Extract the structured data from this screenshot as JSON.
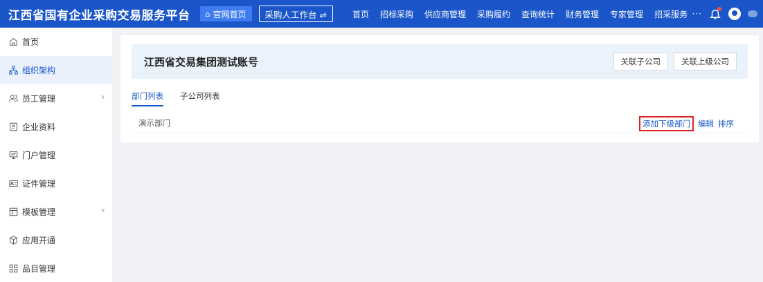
{
  "topbar": {
    "title": "江西省国有企业采购交易服务平台",
    "home_label": "官网首页",
    "workbench_label": "采购人工作台 ⇌",
    "nav": [
      "首页",
      "招标采购",
      "供应商管理",
      "采购履约",
      "查询统计",
      "财务管理",
      "专家管理",
      "招采服务"
    ],
    "more": "···"
  },
  "sidebar": {
    "items": [
      {
        "label": "首页",
        "icon": "home-icon",
        "active": false,
        "expandable": false
      },
      {
        "label": "组织架构",
        "icon": "org-icon",
        "active": true,
        "expandable": false
      },
      {
        "label": "员工管理",
        "icon": "users-icon",
        "active": false,
        "expandable": true
      },
      {
        "label": "企业资料",
        "icon": "document-icon",
        "active": false,
        "expandable": false
      },
      {
        "label": "门户管理",
        "icon": "monitor-icon",
        "active": false,
        "expandable": false
      },
      {
        "label": "证件管理",
        "icon": "id-card-icon",
        "active": false,
        "expandable": false
      },
      {
        "label": "模板管理",
        "icon": "template-icon",
        "active": false,
        "expandable": true
      },
      {
        "label": "应用开通",
        "icon": "box-icon",
        "active": false,
        "expandable": false
      },
      {
        "label": "品目管理",
        "icon": "grid-icon",
        "active": false,
        "expandable": false
      }
    ]
  },
  "main": {
    "company_name": "江西省交易集团测试账号",
    "link_sub_label": "关联子公司",
    "link_parent_label": "关联上级公司",
    "tabs": [
      {
        "label": "部门列表",
        "active": true
      },
      {
        "label": "子公司列表",
        "active": false
      }
    ],
    "departments": [
      {
        "name": "演示部门",
        "actions": {
          "add_sub": "添加下级部门",
          "edit": "编辑",
          "sort": "排序"
        }
      }
    ]
  },
  "colors": {
    "brand": "#1a56c9",
    "highlight_border": "#e0201c",
    "page_bg": "#f0f2f5",
    "company_bar_bg": "#eaf2fc"
  }
}
